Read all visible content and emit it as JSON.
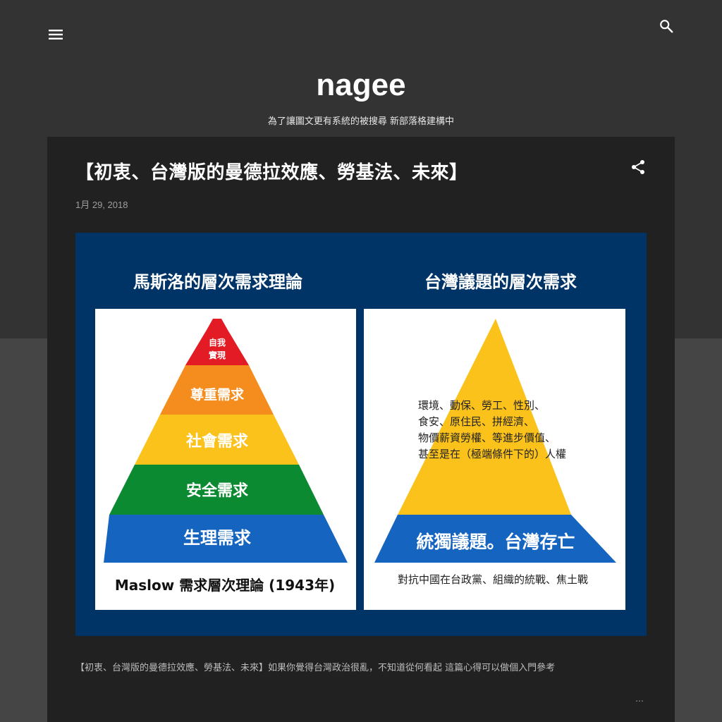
{
  "header": {
    "menu_icon": "hamburger-menu-icon",
    "search_icon": "search-icon",
    "blog_title": "nagee",
    "blog_description": "為了讓圖文更有系統的被搜尋 新部落格建構中"
  },
  "post": {
    "title": "【初衷、台灣版的曼德拉效應、勞基法、未來】",
    "share_icon": "share-icon",
    "date": "1月 29, 2018",
    "snippet": "【初衷、台灣版的曼德拉效應、勞基法、未來】如果你覺得台灣政治很亂，不知道從何看起 這篇心得可以做個入門參考",
    "more_label": "…"
  },
  "image": {
    "left_heading": "馬斯洛的層次需求理論",
    "right_heading": "台灣議題的層次需求",
    "left_pyramid": [
      {
        "label": "自我",
        "label2": "實現",
        "color": "#e21b24"
      },
      {
        "label": "尊重需求",
        "color": "#f58d1e"
      },
      {
        "label": "社會需求",
        "color": "#fbc21b"
      },
      {
        "label": "安全需求",
        "color": "#0c8a32"
      },
      {
        "label": "生理需求",
        "color": "#1565c0"
      }
    ],
    "left_caption": "Maslow 需求層次理論 (1943年)",
    "right_pyramid_text": [
      "環境、動保、勞工、性別、",
      "食安、原住民、拼經濟、",
      "物價薪資勞權、等進步價值、",
      "甚至是在（極端條件下的）人權"
    ],
    "right_base_label": "統獨議題。台灣存亡",
    "right_caption": "對抗中國在台政黨、組織的統戰、焦土戰",
    "colors": {
      "background": "#013466",
      "top": "#fbc21b",
      "base": "#1565c0"
    }
  }
}
